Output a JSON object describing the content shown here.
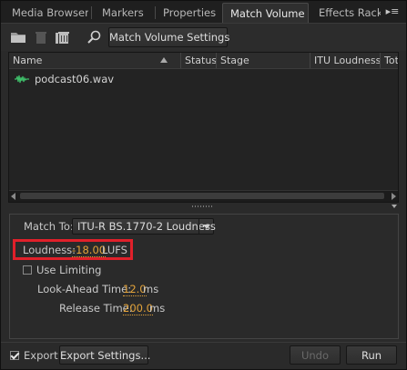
{
  "tabs": [
    {
      "label": "Media Browser"
    },
    {
      "label": "Markers"
    },
    {
      "label": "Properties"
    },
    {
      "label": "Match Volume",
      "active": true
    },
    {
      "label": "Effects Rack"
    }
  ],
  "tab_close_glyph": "×",
  "panel_menu_glyph": "▸≡",
  "toolbar": {
    "icons": [
      "open-folder-icon",
      "trash-icon",
      "remove-all-icon",
      "magnifier-icon"
    ],
    "settings_button": "Match Volume Settings"
  },
  "list": {
    "columns": [
      "Name",
      "Status",
      "Stage",
      "ITU Loudness",
      "Tota"
    ],
    "rows": [
      {
        "name": "podcast06.wav",
        "status": "",
        "stage": "",
        "itu_loudness": "",
        "total": ""
      }
    ]
  },
  "match": {
    "label": "Match To:",
    "selected": "ITU-R BS.1770-2 Loudness",
    "loudness_label": "Loudness:",
    "loudness_value": "-18.00",
    "loudness_unit": "LUFS",
    "use_limiting_label": "Use Limiting",
    "use_limiting_checked": false,
    "lookahead_label": "Look-Ahead Time:",
    "lookahead_value": "12.0",
    "lookahead_unit": "ms",
    "release_label": "Release Time:",
    "release_value": "200.0",
    "release_unit": "ms"
  },
  "footer": {
    "export_label": "Export",
    "export_checked": true,
    "export_settings_button": "Export Settings...",
    "undo_button": "Undo",
    "run_button": "Run"
  },
  "colors": {
    "value_accent": "#e3a33a",
    "highlight_box": "#e0202a",
    "wave_icon": "#3fbf6a"
  }
}
